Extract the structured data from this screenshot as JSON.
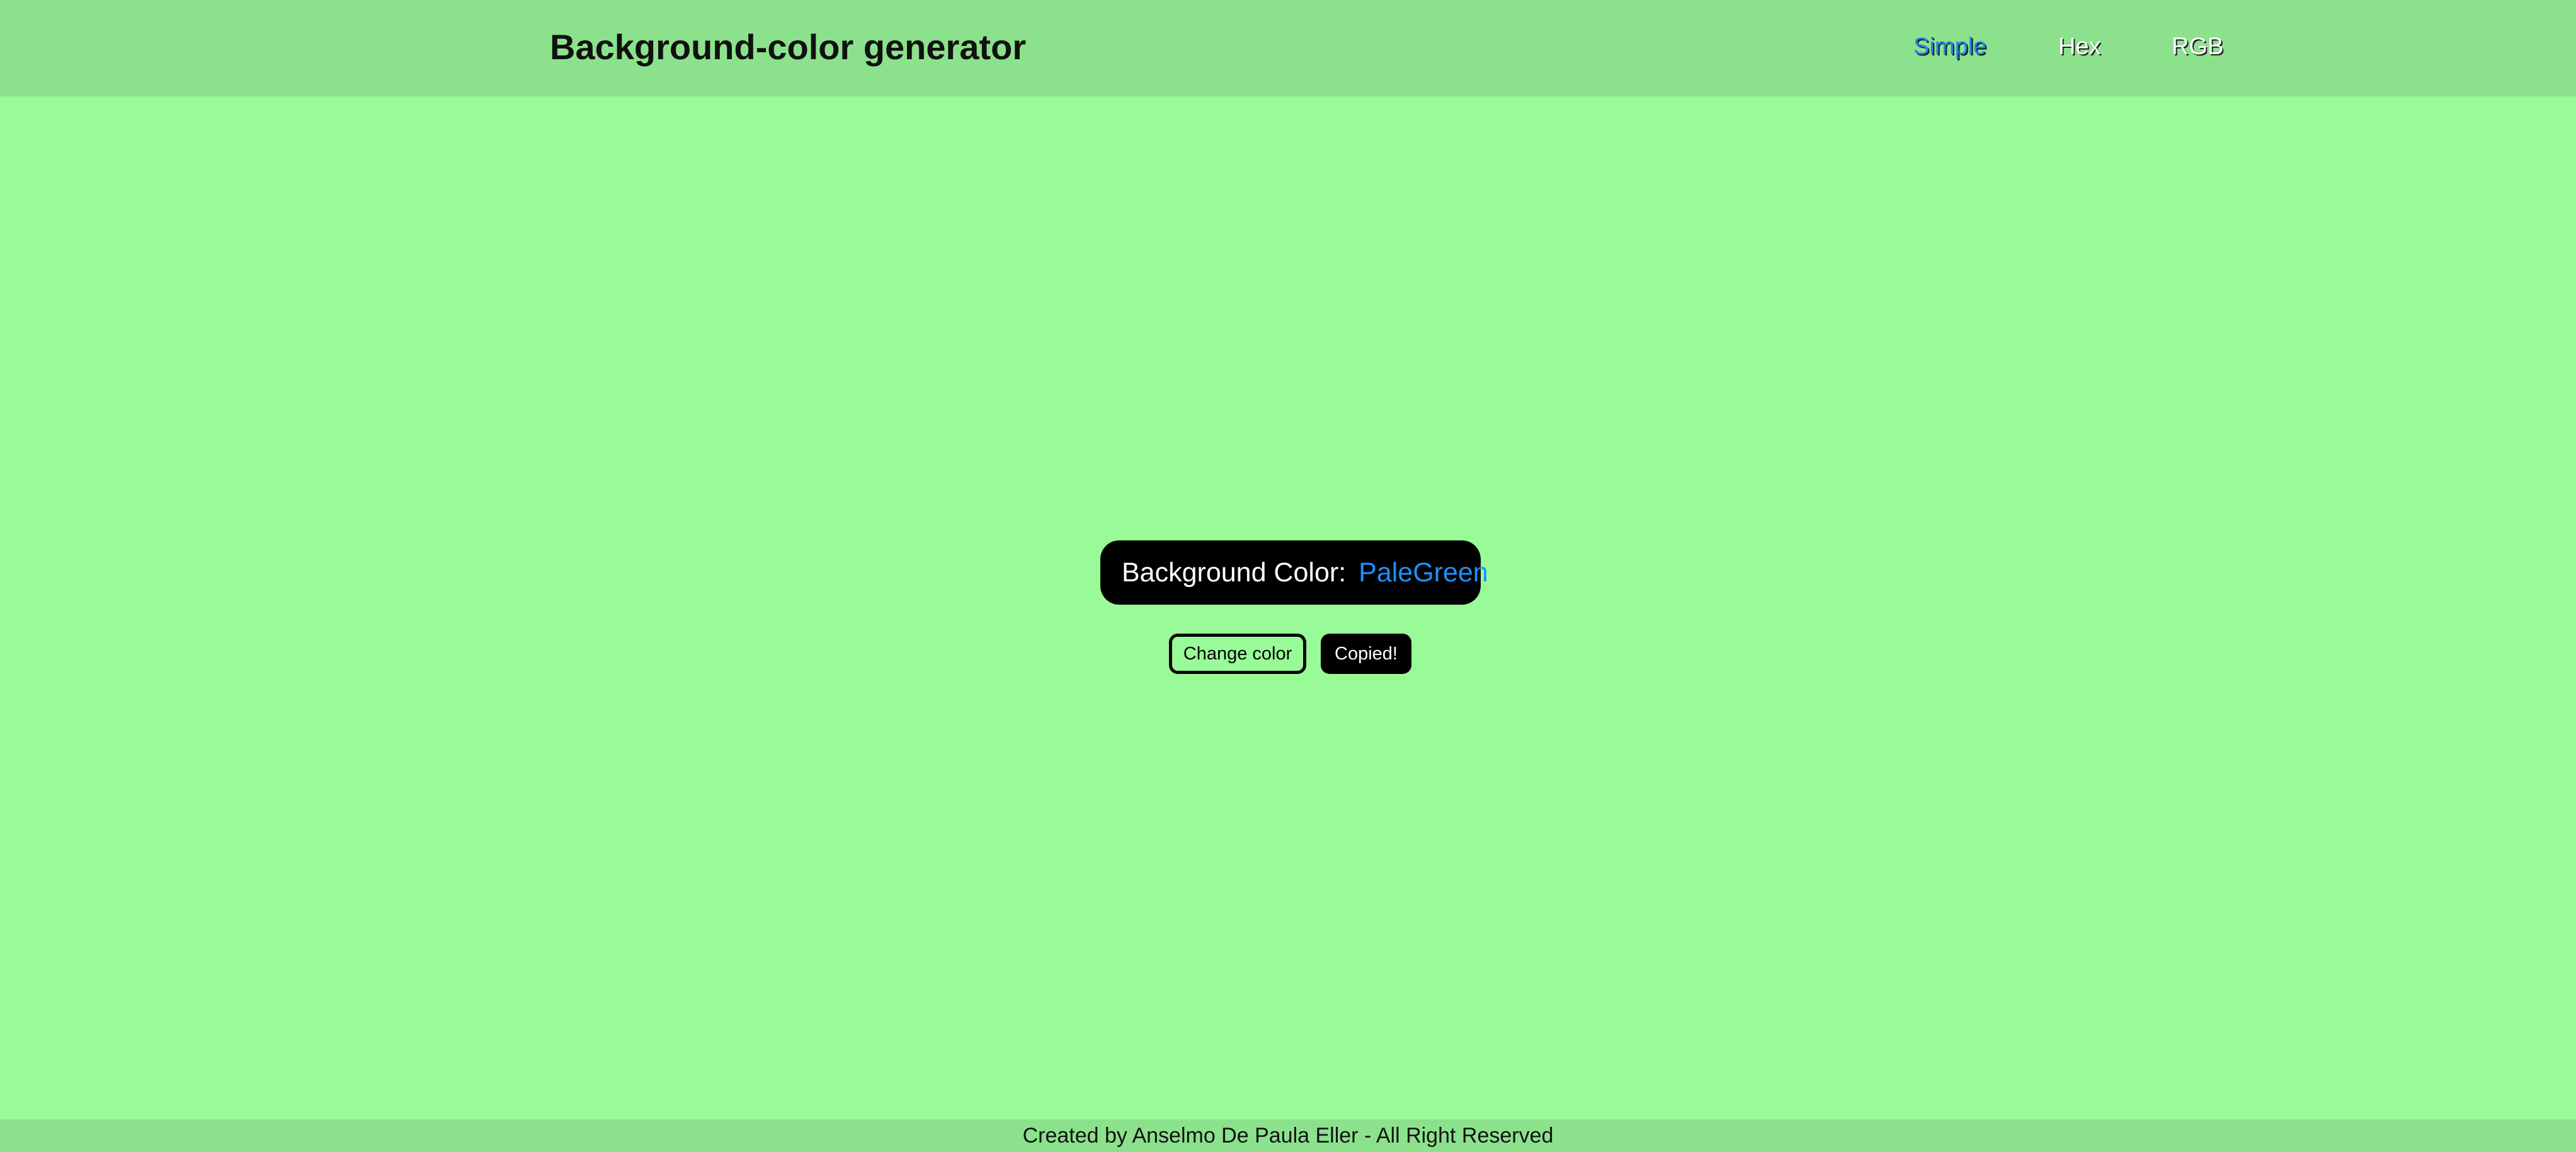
{
  "header": {
    "title": "Background-color generator",
    "nav": {
      "simple": "Simple",
      "hex": "Hex",
      "rgb": "RGB",
      "active": "Simple"
    }
  },
  "main": {
    "color_label": "Background Color:",
    "color_value": "PaleGreen",
    "change_button": "Change color",
    "copy_button": "Copied!"
  },
  "footer": {
    "text": "Created by Anselmo De Paula Eller - All Right Reserved"
  },
  "colors": {
    "background": "#98fb98",
    "header_footer": "#8ce28c",
    "accent": "#1e90ff",
    "pill": "#000000"
  }
}
